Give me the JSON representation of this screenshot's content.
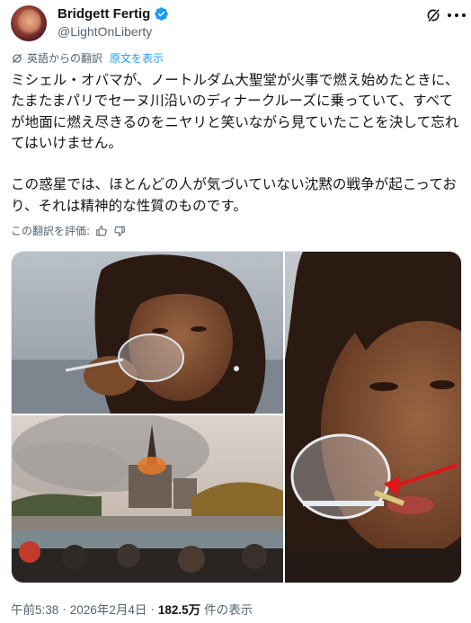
{
  "author": {
    "display_name": "Bridgett Fertig",
    "handle": "@LightOnLiberty",
    "verified": true
  },
  "translation": {
    "notice": "英語からの翻訳",
    "show_original": "原文を表示"
  },
  "tweet": {
    "text": "ミシェル・オバマが、ノートルダム大聖堂が火事で燃え始めたときに、たまたまパリでセーヌ川沿いのディナークルーズに乗っていて、すべてが地面に燃え尽きるのをニヤリと笑いながら見ていたことを決して忘れてはいけません。\n\nこの惑星では、ほとんどの人が気づいていない沈黙の戦争が起こっており、それは精神的な性質のものです。"
  },
  "rate_translation": {
    "label": "この翻訳を評価:"
  },
  "media": {
    "photos": [
      {
        "name": "woman-drinking-wine-photo"
      },
      {
        "name": "notre-dame-fire-photo"
      },
      {
        "name": "wine-glass-closeup-photo"
      }
    ],
    "annotation": {
      "color": "#e0161b"
    }
  },
  "footer": {
    "time": "午前5:38",
    "separator1": "·",
    "date": "2026年2月4日",
    "separator2": "·",
    "views_count": "182.5万",
    "views_label": "件の表示"
  },
  "colors": {
    "text": "#0f1419",
    "secondary": "#536471",
    "link": "#1d9bf0",
    "verified": "#1d9bf0"
  },
  "icons": [
    "verified-badge-icon",
    "grok-icon",
    "more-options-icon",
    "translate-icon",
    "thumbs-up-icon",
    "thumbs-down-icon"
  ]
}
